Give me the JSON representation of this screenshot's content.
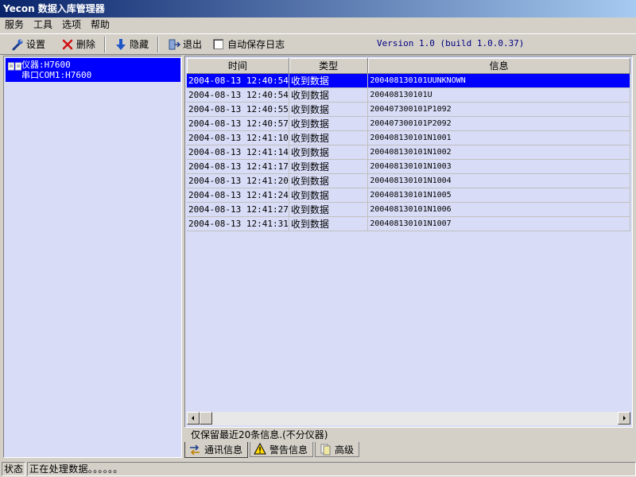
{
  "window": {
    "title": "Yecon 数据入库管理器"
  },
  "menu": [
    "服务",
    "工具",
    "选项",
    "帮助"
  ],
  "toolbar": {
    "settings": "设置",
    "delete": "删除",
    "hide": "隐藏",
    "exit": "退出",
    "autosave_label": "自动保存日志",
    "autosave_checked": false,
    "version": "Version 1.0  (build 1.0.0.37)"
  },
  "tree": {
    "line1": "仪器:H7600",
    "line2": "串口COM1:H7600"
  },
  "table": {
    "headers": [
      "时间",
      "类型",
      "信息"
    ],
    "rows": [
      {
        "time": "2004-08-13 12:40:54",
        "type": "收到数据",
        "msg": "200408130101UUNKNOWN",
        "selected": true
      },
      {
        "time": "2004-08-13 12:40:54",
        "type": "收到数据",
        "msg": "200408130101U"
      },
      {
        "time": "2004-08-13 12:40:55",
        "type": "收到数据",
        "msg": "200407300101P1092"
      },
      {
        "time": "2004-08-13 12:40:57",
        "type": "收到数据",
        "msg": "200407300101P2092"
      },
      {
        "time": "2004-08-13 12:41:10",
        "type": "收到数据",
        "msg": "200408130101N1001"
      },
      {
        "time": "2004-08-13 12:41:14",
        "type": "收到数据",
        "msg": "200408130101N1002"
      },
      {
        "time": "2004-08-13 12:41:17",
        "type": "收到数据",
        "msg": "200408130101N1003"
      },
      {
        "time": "2004-08-13 12:41:20",
        "type": "收到数据",
        "msg": "200408130101N1004"
      },
      {
        "time": "2004-08-13 12:41:24",
        "type": "收到数据",
        "msg": "200408130101N1005"
      },
      {
        "time": "2004-08-13 12:41:27",
        "type": "收到数据",
        "msg": "200408130101N1006"
      },
      {
        "time": "2004-08-13 12:41:31",
        "type": "收到数据",
        "msg": "200408130101N1007"
      }
    ]
  },
  "info_text": "仅保留最近20条信息.(不分仪器)",
  "tabs": [
    "通讯信息",
    "警告信息",
    "高级"
  ],
  "status": {
    "label": "状态",
    "text": "正在处理数据。。。。。。"
  },
  "colors": {
    "selection": "#0000ff",
    "panel_bg": "#d8dcf6",
    "chrome": "#d4d0c8"
  }
}
